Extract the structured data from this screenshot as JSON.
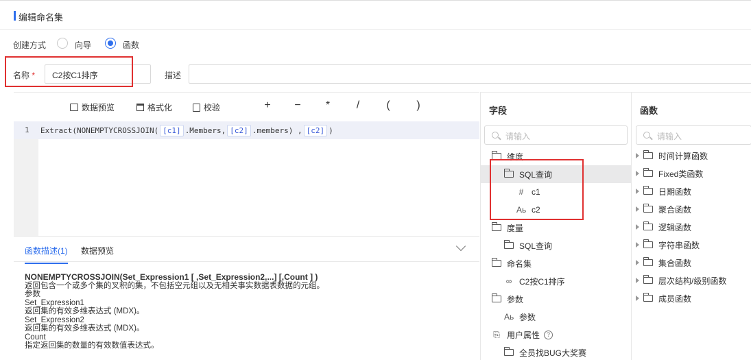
{
  "header": {
    "title": "编辑命名集"
  },
  "create_mode": {
    "label": "创建方式",
    "options": [
      {
        "label": "向导",
        "selected": false
      },
      {
        "label": "函数",
        "selected": true
      }
    ]
  },
  "name_field": {
    "label": "名称",
    "required_mark": "*",
    "value": "C2按C1排序"
  },
  "desc_field": {
    "label": "描述",
    "value": ""
  },
  "toolbar": {
    "preview_label": "数据预览",
    "format_label": "格式化",
    "validate_label": "校验",
    "operators": [
      "+",
      "−",
      "*",
      "/",
      "(",
      ")"
    ]
  },
  "editor": {
    "line_number": "1",
    "code_parts": [
      {
        "text": "Extract(NONEMPTYCROSSJOIN(",
        "token": false
      },
      {
        "text": "[c1]",
        "token": true
      },
      {
        "text": ".Members,",
        "token": false
      },
      {
        "text": "[c2]",
        "token": true
      },
      {
        "text": ".members) ,",
        "token": false
      },
      {
        "text": "[c2]",
        "token": true
      },
      {
        "text": ")",
        "token": false
      }
    ]
  },
  "desc_tabs": {
    "tab1": "函数描述(1)",
    "tab2": "数据预览"
  },
  "description": {
    "signature": "NONEMPTYCROSSJOIN(Set_Expression1 [ ,Set_Expression2,...] [,Count ] )",
    "lines": [
      "返回包含一个或多个集的叉积的集，不包括空元组以及无相关事实数据表数据的元组。",
      "参数",
      "Set_Expression1",
      "返回集的有效多维表达式 (MDX)。",
      "Set_Expression2",
      "返回集的有效多维表达式 (MDX)。",
      "Count",
      "指定返回集的数量的有效数值表达式。"
    ]
  },
  "fields": {
    "title": "字段",
    "search_placeholder": "请输入",
    "items": [
      {
        "label": "维度",
        "icon": "folder-icon"
      },
      {
        "label": "SQL查询",
        "icon": "folder-icon"
      },
      {
        "label": "c1",
        "icon": "#"
      },
      {
        "label": "c2",
        "icon": "Aь"
      },
      {
        "label": "度量",
        "icon": "folder-icon"
      },
      {
        "label": "SQL查询",
        "icon": "folder-icon"
      },
      {
        "label": "命名集",
        "icon": "folder-icon"
      },
      {
        "label": "C2按C1排序",
        "icon": "named-set-icon"
      },
      {
        "label": "参数",
        "icon": "folder-icon"
      },
      {
        "label": "参数",
        "icon": "Aь"
      },
      {
        "label": "用户属性",
        "icon": "user-attr-icon"
      },
      {
        "label": "?",
        "icon": "help-icon"
      },
      {
        "label": "全员找BUG大奖赛",
        "icon": "folder-icon"
      }
    ]
  },
  "functions": {
    "title": "函数",
    "search_placeholder": "请输入",
    "items": [
      "时间计算函数",
      "Fixed类函数",
      "日期函数",
      "聚合函数",
      "逻辑函数",
      "字符串函数",
      "集合函数",
      "层次结构/级别函数",
      "成员函数"
    ]
  },
  "colors": {
    "accent": "#2f6fed",
    "highlight": "#e03131"
  }
}
